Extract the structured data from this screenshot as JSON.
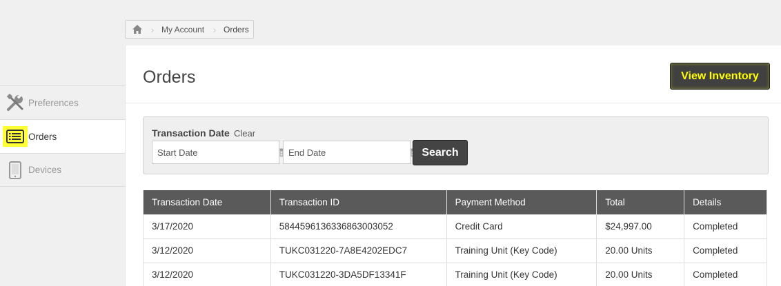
{
  "breadcrumb": {
    "items": [
      "My Account",
      "Orders"
    ]
  },
  "sidebar": {
    "items": [
      {
        "label": "Preferences",
        "icon": "tools-icon"
      },
      {
        "label": "Orders",
        "icon": "list-icon",
        "active": true
      },
      {
        "label": "Devices",
        "icon": "tablet-icon"
      }
    ]
  },
  "page": {
    "title": "Orders",
    "view_inventory_label": "View Inventory"
  },
  "filter": {
    "label": "Transaction Date",
    "clear_label": "Clear",
    "start_placeholder": "Start Date",
    "end_placeholder": "End Date",
    "search_label": "Search"
  },
  "table": {
    "headers": [
      "Transaction Date",
      "Transaction ID",
      "Payment Method",
      "Total",
      "Details"
    ],
    "rows": [
      [
        "3/17/2020",
        "5844596136336863003052",
        "Credit Card",
        "$24,997.00",
        "Completed"
      ],
      [
        "3/12/2020",
        "TUKC031220-7A8E4202EDC7",
        "Training Unit (Key Code)",
        "20.00 Units",
        "Completed"
      ],
      [
        "3/12/2020",
        "TUKC031220-3DA5DF13341F",
        "Training Unit (Key Code)",
        "20.00 Units",
        "Completed"
      ]
    ]
  },
  "colors": {
    "highlight": "#ffff00",
    "button_dark": "#404040",
    "table_header": "#5a5a5a"
  }
}
